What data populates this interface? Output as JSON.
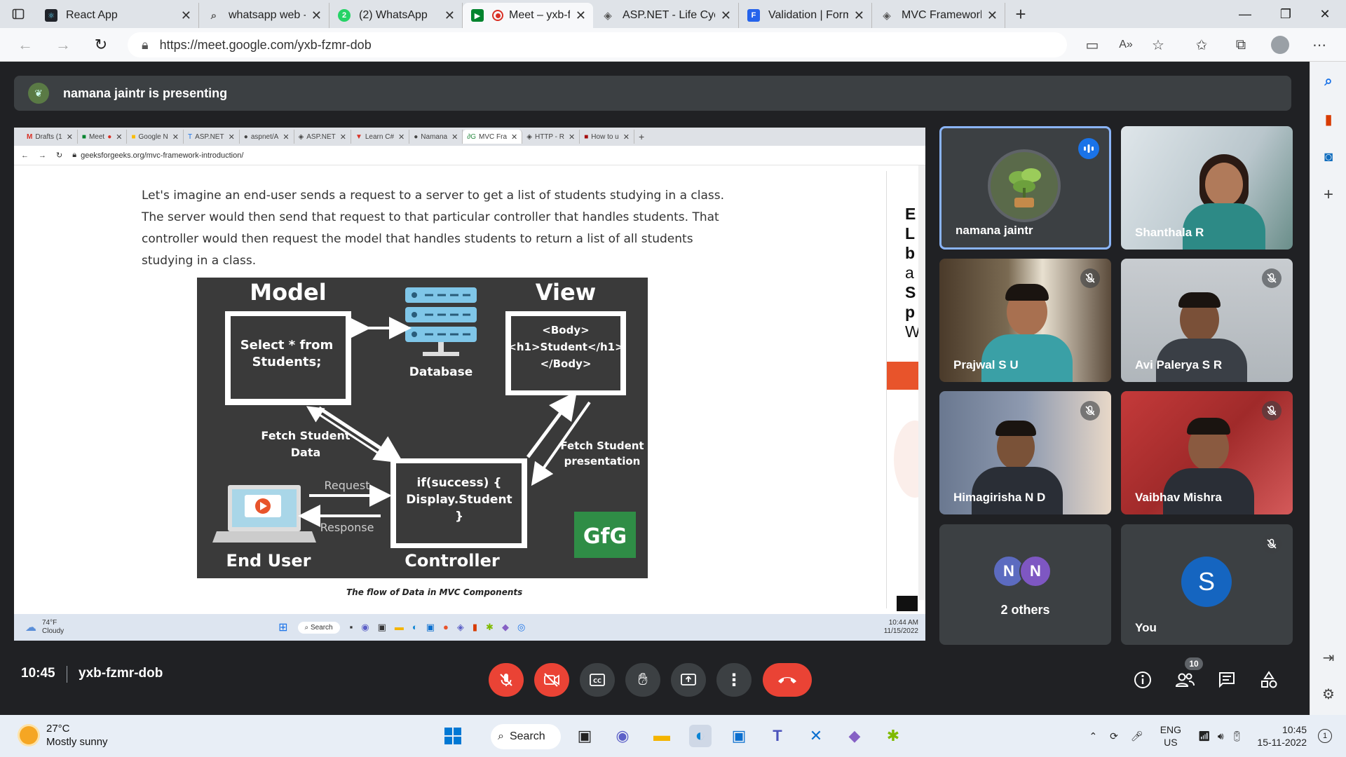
{
  "browser": {
    "tabs": [
      {
        "label": "React App",
        "favicon": "react-icon"
      },
      {
        "label": "whatsapp web - Searc",
        "favicon": "search-icon"
      },
      {
        "label": "(2) WhatsApp",
        "favicon": "whatsapp-icon"
      },
      {
        "label": "Meet – yxb-fzmr-",
        "favicon": "meet-icon",
        "active": true
      },
      {
        "label": "ASP.NET - Life Cycle",
        "favicon": "asp-icon"
      },
      {
        "label": "Validation | Formik",
        "favicon": "formik-icon"
      },
      {
        "label": "MVC Framework - Intr",
        "favicon": "asp-icon"
      }
    ],
    "url": "https://meet.google.com/yxb-fzmr-dob"
  },
  "meet": {
    "presenting_banner": "namana jaintr is presenting",
    "time": "10:45",
    "meeting_code": "yxb-fzmr-dob",
    "participant_count": "10",
    "participants": [
      {
        "name": "namana jaintr",
        "speaking": true
      },
      {
        "name": "Shanthala R"
      },
      {
        "name": "Prajwal S U",
        "muted": true
      },
      {
        "name": "Avi Palerya S R",
        "muted": true
      },
      {
        "name": "Himagirisha N D",
        "muted": true
      },
      {
        "name": "Vaibhav Mishra",
        "muted": true
      }
    ],
    "others_tile": {
      "initials": [
        "N",
        "N"
      ],
      "label": "2 others"
    },
    "you_tile": {
      "initial": "S",
      "label": "You"
    }
  },
  "presented": {
    "inner_tabs": [
      "Drafts (1",
      "Meet",
      "Google N",
      "ASP.NET",
      "aspnet/A",
      "ASP.NET",
      "Learn C#",
      "Namana",
      "MVC Fra",
      "HTTP - R",
      "How to u"
    ],
    "inner_url": "geeksforgeeks.org/mvc-framework-introduction/",
    "article_lines": [
      "Let's imagine an end-user sends a request to a server to get a list of students studying in a class.",
      "The server would then send that request to that particular controller that handles students. That",
      "controller would then request the model that handles students to return a list of all students",
      "studying in a class."
    ],
    "diagram": {
      "model_title": "Model",
      "model_box": [
        "Select * from",
        "Students;"
      ],
      "database_label": "Database",
      "view_title": "View",
      "view_box": [
        "<Body>",
        "<h1>Student</h1>",
        "</Body>"
      ],
      "fetch_data": [
        "Fetch Student",
        "Data"
      ],
      "fetch_presentation": [
        "Fetch Student",
        "presentation"
      ],
      "controller_box": [
        "if(success) {",
        "Display.Student",
        "}"
      ],
      "controller_label": "Controller",
      "request_label": "Request",
      "response_label": "Response",
      "end_user_label": "End User",
      "logo": "GfG"
    },
    "caption": "The flow of Data in MVC Components",
    "right_panel_letters": [
      "E",
      "L",
      "b",
      "a",
      "S",
      "p",
      "W"
    ],
    "inner_taskbar": {
      "weather_temp": "74°F",
      "weather_desc": "Cloudy",
      "search": "Search",
      "time": "10:44 AM",
      "date": "11/15/2022"
    }
  },
  "taskbar": {
    "weather_temp": "27°C",
    "weather_desc": "Mostly sunny",
    "search_label": "Search",
    "lang": "ENG",
    "region": "US",
    "time": "10:45",
    "date": "15-11-2022",
    "notification_count": "1"
  },
  "colors": {
    "meet_bg": "#202124",
    "leave_red": "#ea4335",
    "speaking_blue": "#8ab4f8",
    "gfg_green": "#2f8d46"
  }
}
